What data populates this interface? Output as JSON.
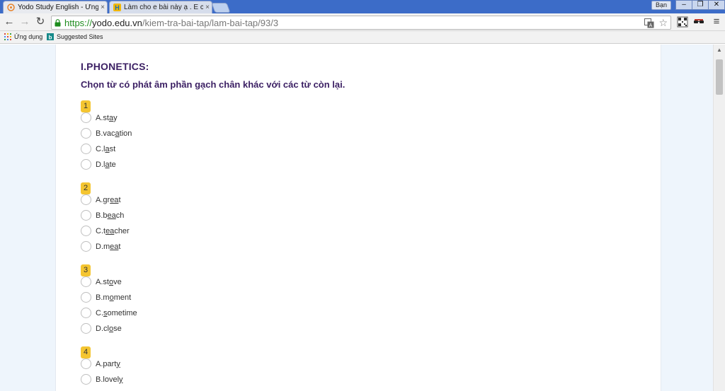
{
  "browser": {
    "tabs": [
      {
        "label": "Yodo Study English - Ứng dụ",
        "close": "×"
      },
      {
        "label": "Làm cho e bài này ạ . E cảm",
        "close": "×"
      }
    ],
    "user_label": "Bạn",
    "window_controls": {
      "minimize": "–",
      "restore": "❐",
      "close": "✕"
    },
    "url": {
      "scheme": "https://",
      "host": "yodo.edu.vn",
      "path": "/kiem-tra-bai-tap/lam-bai-tap/93/3"
    },
    "bookmarks": [
      {
        "label": "Ứng dụng"
      },
      {
        "label": "Suggested Sites"
      }
    ]
  },
  "quiz": {
    "section_title": "I.PHONETICS:",
    "instruction": "Chọn từ có phát âm phần gạch chân khác với các từ còn lại.",
    "questions": [
      {
        "number": "1",
        "options": [
          {
            "prefix": "A. ",
            "before": "st",
            "under": "a",
            "after": "y"
          },
          {
            "prefix": "B. ",
            "before": "vac",
            "under": "a",
            "after": "tion"
          },
          {
            "prefix": "C. ",
            "before": "l",
            "under": "a",
            "after": "st"
          },
          {
            "prefix": "D. ",
            "before": "l",
            "under": "a",
            "after": "te"
          }
        ]
      },
      {
        "number": "2",
        "options": [
          {
            "prefix": "A. ",
            "before": "gr",
            "under": "ea",
            "after": "t"
          },
          {
            "prefix": "B. ",
            "before": "b",
            "under": "ea",
            "after": "ch"
          },
          {
            "prefix": "C. ",
            "before": "t",
            "under": "ea",
            "after": "cher"
          },
          {
            "prefix": "D. ",
            "before": "m",
            "under": "ea",
            "after": "t"
          }
        ]
      },
      {
        "number": "3",
        "options": [
          {
            "prefix": "A. ",
            "before": "st",
            "under": "o",
            "after": "ve"
          },
          {
            "prefix": "B. ",
            "before": "m",
            "under": "o",
            "after": "ment"
          },
          {
            "prefix": "C. ",
            "before": "",
            "under": "s",
            "after": "ometime"
          },
          {
            "prefix": "D. ",
            "before": "cl",
            "under": "o",
            "after": "se"
          }
        ]
      },
      {
        "number": "4",
        "options": [
          {
            "prefix": "A. ",
            "before": "part",
            "under": "y",
            "after": ""
          },
          {
            "prefix": "B. ",
            "before": "lovel",
            "under": "y",
            "after": ""
          }
        ]
      }
    ]
  },
  "colors": {
    "heading": "#3b1f63",
    "badge": "#f4c531",
    "secure_url": "#1d8c1d",
    "page_background": "#eef5fc",
    "titlebar": "#3c6cc8"
  }
}
